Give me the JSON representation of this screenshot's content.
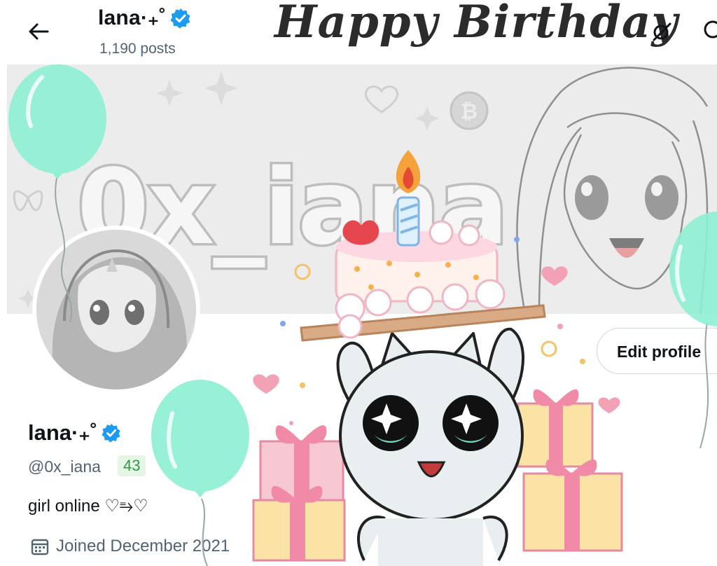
{
  "header": {
    "name": "lana·₊˚",
    "posts": "1,190 posts",
    "overlay_title": "Happy Birthday"
  },
  "banner": {
    "text": "0x_iana"
  },
  "profile": {
    "name": "lana·₊˚",
    "handle": "@0x_iana",
    "handle_badge": "43",
    "bio": "girl online ♡⥱♡",
    "joined": "Joined December 2021",
    "edit_profile_label": "Edit profile"
  },
  "colors": {
    "verified": "#1d9bf0",
    "balloon": "#8ef0d4",
    "muted_text": "#536471",
    "badge_text": "#2d9a46",
    "cake_pink": "#f3a1b4"
  },
  "icons": [
    "back-arrow-icon",
    "verified-badge-icon",
    "grok-icon",
    "search-icon",
    "calendar-icon"
  ]
}
